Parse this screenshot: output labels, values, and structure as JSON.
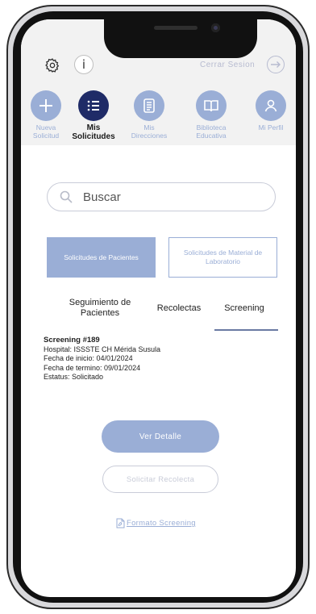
{
  "header": {
    "info_glyph": "i",
    "logout_label": "Cerrar Sesion"
  },
  "nav": [
    {
      "label": "Nueva\nSolicitud",
      "icon": "plus-icon",
      "active": false
    },
    {
      "label": "Mis\nSolicitudes",
      "icon": "list-icon",
      "active": true
    },
    {
      "label": "Mis\nDirecciones",
      "icon": "document-icon",
      "active": false
    },
    {
      "label": "Biblioteca\nEducativa",
      "icon": "book-icon",
      "active": false
    },
    {
      "label": "Mi Perfil",
      "icon": "user-icon",
      "active": false
    }
  ],
  "search": {
    "placeholder": "Buscar"
  },
  "categories": {
    "active": "Solicitudes de Pacientes",
    "inactive": "Solicitudes de Material de Laboratorio"
  },
  "tabs": [
    {
      "label": "Seguimiento de Pacientes"
    },
    {
      "label": "Recolectas"
    },
    {
      "label": "Screening",
      "active": true
    }
  ],
  "detail": {
    "title": "Screening #189",
    "hospital": "Hospital: ISSSTE CH Mérida Susula",
    "start": "Fecha de inicio: 04/01/2024",
    "end": "Fecha de termino: 09/01/2024",
    "status": "Estatus: Solicitado"
  },
  "actions": {
    "view_detail": "Ver Detalle",
    "request_collection": "Solicitar Recolecta",
    "format_link": "Formato Screening"
  },
  "colors": {
    "accent": "#9aaed6",
    "active_nav": "#1f2b67",
    "header_bg": "#f2f2f2"
  }
}
